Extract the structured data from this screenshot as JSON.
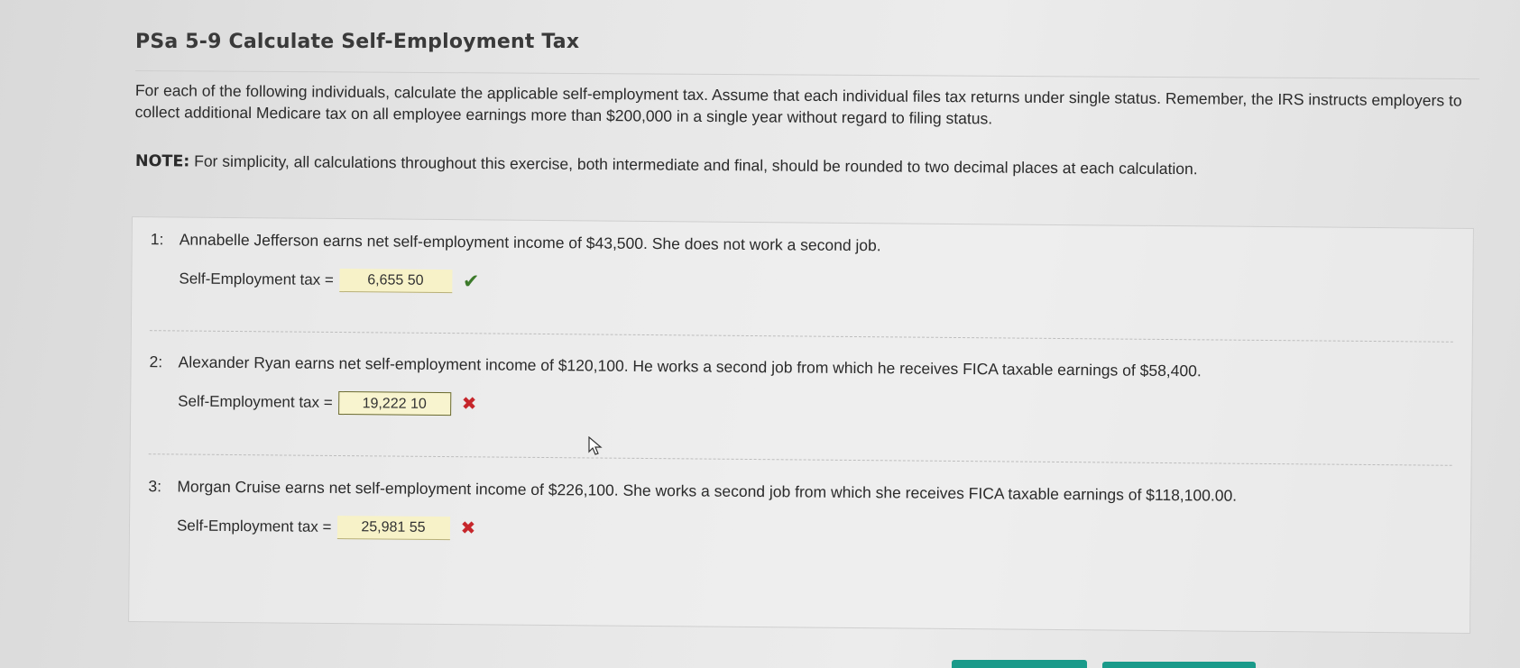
{
  "title": "PSa 5-9 Calculate Self-Employment Tax",
  "intro": "For each of the following individuals, calculate the applicable self-employment tax. Assume that each individual files tax returns under single status. Remember, the IRS instructs employers to collect additional Medicare tax on all employee earnings more than $200,000 in a single year without regard to filing status.",
  "note": {
    "label": "NOTE:",
    "text": " For simplicity, all calculations throughout this exercise, both intermediate and final, should be rounded to two decimal places at each calculation."
  },
  "questions": [
    {
      "number": "1:",
      "text": "Annabelle Jefferson earns net self-employment income of $43,500. She does not work a second job.",
      "answer_label": "Self-Employment tax =",
      "answer_value": "6,655 50",
      "result": "correct",
      "result_icon": "checkmark-icon",
      "result_glyph": "✔"
    },
    {
      "number": "2:",
      "text": "Alexander Ryan earns net self-employment income of $120,100. He works a second job from which he receives FICA taxable earnings of $58,400.",
      "answer_label": "Self-Employment tax =",
      "answer_value": "19,222 10",
      "result": "incorrect",
      "result_icon": "x-icon",
      "result_glyph": "✖"
    },
    {
      "number": "3:",
      "text": "Morgan Cruise earns net self-employment income of $226,100. She works a second job from which she receives FICA taxable earnings of $118,100.00.",
      "answer_label": "Self-Employment tax =",
      "answer_value": "25,981 55",
      "result": "incorrect",
      "result_icon": "x-icon",
      "result_glyph": "✖"
    }
  ],
  "colors": {
    "correct": "#3c7a2a",
    "incorrect": "#c6262b",
    "answer_bg": "#f7f2c8",
    "footer_button": "#1a9a8a"
  }
}
